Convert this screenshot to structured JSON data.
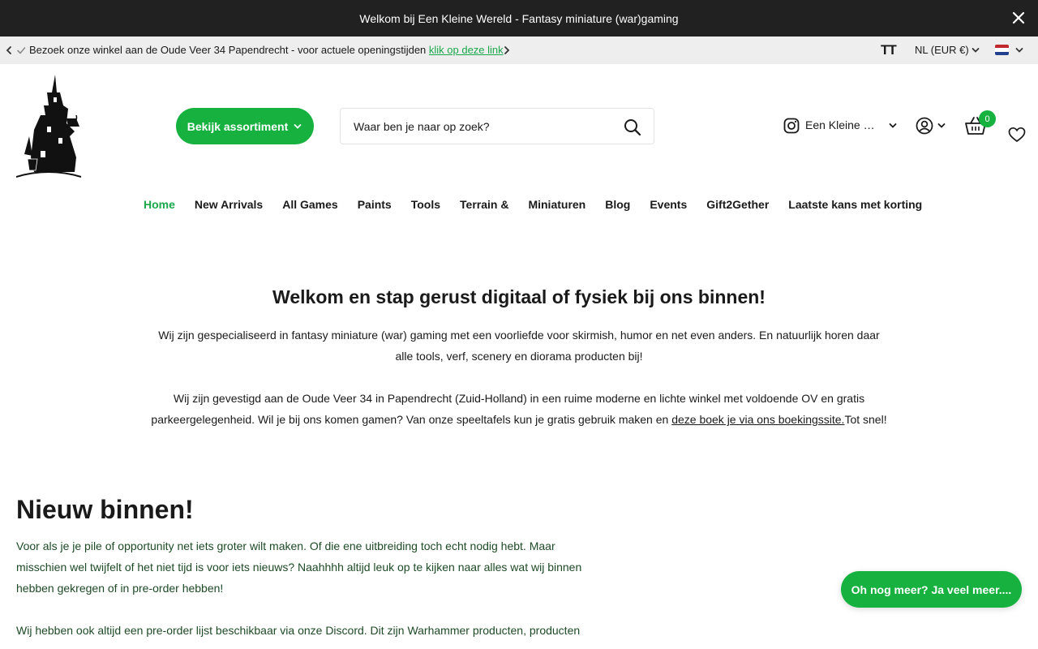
{
  "announcement": {
    "text": "Welkom bij Een Kleine Wereld - Fantasy miniature (war)gaming"
  },
  "usp": {
    "text": "Bezoek onze winkel aan de Oude Veer 34 Papendrecht - voor actuele openingstijden ",
    "link": "klik op deze link",
    "font_size_toggle": "TT",
    "language": "NL (EUR €)"
  },
  "header": {
    "assortment_button": "Bekijk assortiment",
    "search_placeholder": "Waar ben je naar op zoek?",
    "instagram_label": "Een Kleine Wereld",
    "cart_count": "0"
  },
  "nav": {
    "items": [
      {
        "label": "Home"
      },
      {
        "label": "New Arrivals"
      },
      {
        "label": "All Games"
      },
      {
        "label": "Paints"
      },
      {
        "label": "Tools"
      },
      {
        "label": "Terrain &"
      },
      {
        "label": "Miniaturen"
      },
      {
        "label": "Blog"
      },
      {
        "label": "Events"
      },
      {
        "label": "Gift2Gether"
      },
      {
        "label": "Laatste kans met korting"
      }
    ]
  },
  "welcome": {
    "title": "Welkom en stap gerust digitaal of fysiek bij ons binnen!",
    "p1_line1": "Wij zijn gespecialiseerd in fantasy miniature (war) gaming met een voorliefde voor skirmish, humor en net even anders. En natuurlijk horen daar",
    "p1_line2": "alle tools, verf, scenery en diorama producten bij!",
    "p2_line1": "Wij zijn gevestigd aan de Oude Veer 34 in Papendrecht (Zuid-Holland) in een ruime moderne en lichte winkel met voldoende OV en gratis",
    "p2_line2_start": "parkeergelegenheid. Wil je bij ons komen gamen? Van onze speeltafels kun je gratis gebruik maken en ",
    "p2_link": "deze boek je via ons boekingssite.",
    "p2_line2_end": "Tot snel!"
  },
  "new_arrivals": {
    "title": "Nieuw binnen!",
    "p1_line1": "Voor als je je pile of opportunity net iets groter wilt maken. Of die ene uitbreiding toch echt nodig hebt. Maar",
    "p1_line2": "misschien wel twijfelt of het niet tijd is voor iets nieuws? Naahhhh altijd leuk op te kijken naar alles wat wij binnen",
    "p1_line3": "hebben gekregen of in pre-order hebben!",
    "p2_line1": "Wij hebben ook altijd een pre-order lijst beschikbaar via onze Discord. Dit zijn Warhammer producten, producten"
  },
  "floating_button": "Oh nog meer? Ja veel meer....",
  "colors": {
    "accent": "#16b13f",
    "topbar": "#212121",
    "uspbar": "#eeeeee"
  }
}
